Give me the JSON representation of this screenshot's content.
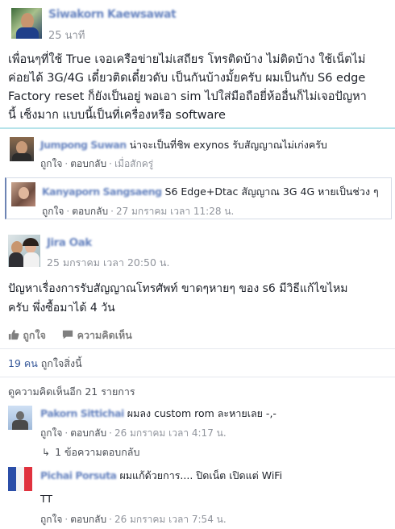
{
  "post": {
    "author": "Siwakorn Kaewsawat",
    "time": "25 นาที",
    "text_lines": [
      "เพื่อนๆที่ใช้ True เจอเครือข่ายไม่เสถียร โทรติดบ้าง ไม่ติดบ้าง ใช้เน็ตไม่",
      "ค่อยได้ 3G/4G เดี๋ยวติดเดี๋ยวดับ เป็นกันบ้างมั้ยครับ ผมเป็นกับ S6 edge",
      "Factory reset ก็ยังเป็นอยู่ พอเอา sim ไปใส่มือถือยี่ห้ออื่นก็ไม่เจอปัญหา",
      "นี้ เซ็งมาก แบบนี้เป็นที่เครื่องหรือ software"
    ]
  },
  "comment1": {
    "author": "Jumpong Suwan",
    "text": "น่าจะเป็นที่ชิพ exynos รับสัญญาณไม่เก่งครับ",
    "like": "ถูกใจ",
    "reply": "ตอบกลับ",
    "time": "เมื่อสักครู่"
  },
  "comment2": {
    "author": "Kanyaporn Sangsaeng",
    "text": "S6 Edge+Dtac สัญญาณ 3G 4G หายเป็นช่วง ๆ",
    "like": "ถูกใจ",
    "reply": "ตอบกลับ",
    "time": "27 มกราคม เวลา 11:28 น."
  },
  "post2": {
    "author": "Jira Oak",
    "time": "25 มกราคม เวลา 20:50 น.",
    "text_lines": [
      "ปัญหาเรื่องการรับสัญญาณโทรศัพท์ ขาดๆหายๆ ของ s6 มีวิธีแก้ไขไหม",
      "ครับ พึ่งซื้อมาได้ 4 วัน"
    ],
    "like_action": "ถูกใจ",
    "comment_action": "ความคิดเห็น",
    "likes_count": "19 คน",
    "likes_suffix": "ถูกใจสิ่งนี้",
    "more_comments": "ดูความคิดเห็นอีก 21 รายการ"
  },
  "comment3": {
    "author": "Pakorn Sittichai",
    "text": "ผมลง custom rom ละหายเลย -,-",
    "like": "ถูกใจ",
    "reply": "ตอบกลับ",
    "time": "26 มกราคม เวลา 4:17 น.",
    "replies": "1 ข้อความตอบกลับ"
  },
  "comment4": {
    "author": "Pichai Porsuta",
    "text": "ผมแก้ด้วยการ.... ปิดเน็ต เปิดแต่ WiFi",
    "text2": "TT",
    "like": "ถูกใจ",
    "reply": "ตอบกลับ",
    "time": "26 มกราคม เวลา 7:54 น."
  },
  "colors": {
    "link": "#4b4f56",
    "meta": "#90949c",
    "highlight": "#6d84b4",
    "accent_line": "#b6e3ea"
  }
}
